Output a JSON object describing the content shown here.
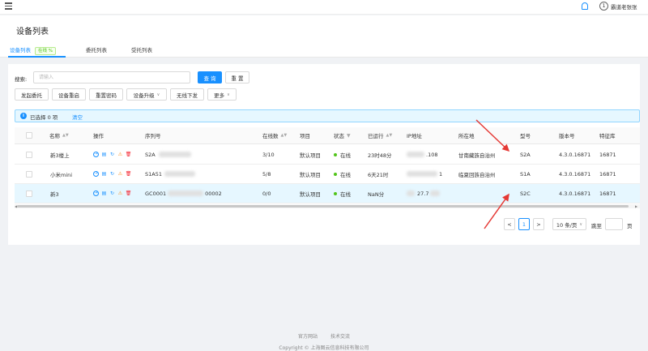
{
  "user": {
    "name": "霸道老张张",
    "avatar_letter": "1"
  },
  "page_title": "设备列表",
  "tabs": [
    {
      "label": "设备列表",
      "tag": "在线 %"
    },
    {
      "label": "委托列表"
    },
    {
      "label": "受托列表"
    }
  ],
  "search": {
    "label": "搜索:",
    "placeholder": "请输入",
    "query_label": "查 询",
    "reset_label": "重 置"
  },
  "actions": [
    "发起委托",
    "设备重启",
    "重置密码",
    "设备升级",
    "无线下发",
    "更多"
  ],
  "alert": {
    "text": "已选择 0 项",
    "clear": "清空"
  },
  "table": {
    "headers": [
      "名称",
      "操作",
      "序列号",
      "在线数",
      "项目",
      "状态",
      "已运行",
      "IP地址",
      "所在地",
      "型号",
      "版本号",
      "特征库"
    ],
    "rows": [
      {
        "name": "新3楼上",
        "serial": "S2A",
        "online": "3/10",
        "project": "默认项目",
        "status": "在线",
        "uptime": "23时48分",
        "ip": ".108",
        "location": "甘南藏族自治州",
        "model": "S2A",
        "version": "4.3.0.16871",
        "feature": "16871"
      },
      {
        "name": "小米mini",
        "serial": "S1A51",
        "online": "5/8",
        "project": "默认项目",
        "status": "在线",
        "uptime": "6天21时",
        "ip": "1",
        "location": "临夏回族自治州",
        "model": "S1A",
        "version": "4.3.0.16871",
        "feature": "16871"
      },
      {
        "name": "新3",
        "serial": "GC0001",
        "serial_tail": "00002",
        "online": "0/0",
        "project": "默认项目",
        "status": "在线",
        "uptime": "NaN分",
        "ip": "27.7",
        "location": "",
        "model": "S2C",
        "version": "4.3.0.16871",
        "feature": "16871"
      }
    ]
  },
  "pagination": {
    "prev": "<",
    "page": "1",
    "next": ">",
    "page_size": "10 条/页",
    "jump_label": "跳至",
    "page_unit": "页"
  },
  "footer": {
    "link1": "官方网站",
    "link2": "技术交流",
    "copyright": "Copyright © 上海图云信息科技有限公司"
  },
  "colors": {
    "accent": "#1890ff",
    "online": "#52c41a",
    "arrow": "#e53935"
  }
}
